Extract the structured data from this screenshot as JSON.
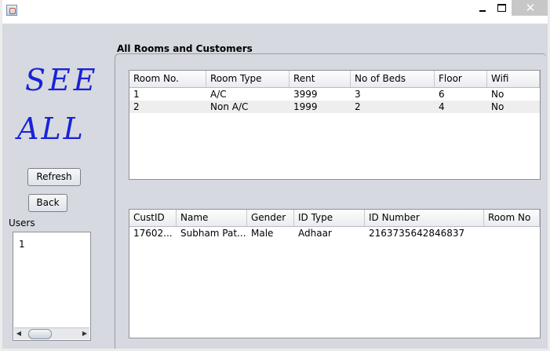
{
  "window": {
    "close_glyph": "✕"
  },
  "sidebar": {
    "heading_line1": "SEE",
    "heading_line2": "ALL",
    "refresh_label": "Refresh",
    "back_label": "Back",
    "users_label": "Users",
    "users_list": [
      "1"
    ]
  },
  "main": {
    "section_title": "All Rooms and Customers",
    "rooms_table": {
      "columns": [
        "Room No.",
        "Room Type",
        "Rent",
        "No of Beds",
        "Floor",
        "Wifi"
      ],
      "rows": [
        [
          "1",
          "A/C",
          "3999",
          "3",
          "6",
          "No"
        ],
        [
          "2",
          "Non A/C",
          "1999",
          "2",
          "4",
          "No"
        ]
      ]
    },
    "customers_table": {
      "columns": [
        "CustID",
        "Name",
        "Gender",
        "ID Type",
        "ID Number",
        "Room No"
      ],
      "rows": [
        [
          "17602...",
          "Subham Pat...",
          "Male",
          "Adhaar",
          "2163735642846837",
          ""
        ]
      ]
    }
  }
}
